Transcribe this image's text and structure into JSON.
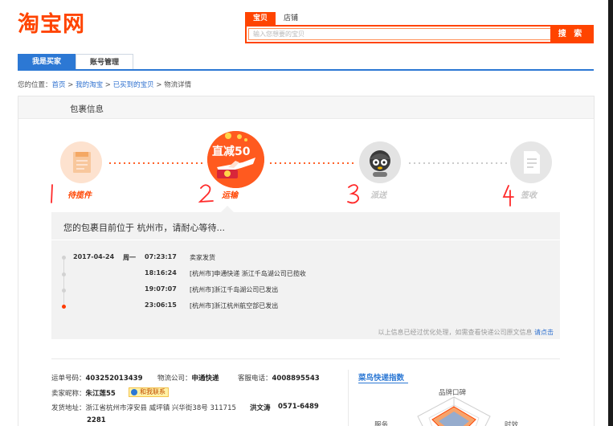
{
  "header": {
    "logo_text": "淘宝网",
    "search_tabs": [
      "宝贝",
      "店铺"
    ],
    "search_placeholder": "输入您想要的宝贝",
    "search_button": "搜 索"
  },
  "nav": {
    "tabs": [
      {
        "label": "我是买家",
        "active": true
      },
      {
        "label": "账号管理",
        "active": false
      }
    ]
  },
  "breadcrumb": {
    "prefix": "您的位置：",
    "items": [
      "首页",
      "我的淘宝",
      "已买到的宝贝"
    ],
    "separator": " > ",
    "current": "物流详情"
  },
  "panel": {
    "title": "包裹信息"
  },
  "steps": [
    {
      "label": "待揽件",
      "icon": "package-icon",
      "annotation": "1",
      "status": "done"
    },
    {
      "label": "运输",
      "icon": "promo-plane-icon",
      "annotation": "2",
      "status": "current",
      "badge": "直减50"
    },
    {
      "label": "派送",
      "icon": "courier-icon",
      "annotation": "3",
      "status": "pending"
    },
    {
      "label": "签收",
      "icon": "document-icon",
      "annotation": "4",
      "status": "pending"
    }
  ],
  "status": {
    "message": "您的包裹目前位于 杭州市，请耐心等待..."
  },
  "timeline": [
    {
      "date": "2017-04-24",
      "weekday": "周一",
      "time": "07:23:17",
      "desc": "卖家发货"
    },
    {
      "date": "",
      "weekday": "",
      "time": "18:16:24",
      "desc": "[杭州市]申通快递 浙江千岛湖公司已揽收"
    },
    {
      "date": "",
      "weekday": "",
      "time": "19:07:07",
      "desc": "[杭州市]浙江千岛湖公司已发出"
    },
    {
      "date": "",
      "weekday": "",
      "time": "23:06:15",
      "desc": "[杭州市]浙江杭州航空部已发出"
    }
  ],
  "footnote": {
    "text": "以上信息已经过优化处理，如需查看快递公司原文信息",
    "link": "请点击"
  },
  "shipment": {
    "tracking_label": "运单号码：",
    "tracking_no": "403252013439",
    "company_label": "物流公司：",
    "company": "申通快递",
    "phone_label": "客服电话：",
    "phone": "4008895543",
    "seller_label": "卖家昵称：",
    "seller": "朱江莲55",
    "contact": "和我联系",
    "address_label": "发货地址：",
    "address": "浙江省杭州市淳安县 威坪镇 兴华街38号 311715",
    "sender": "洪文涛",
    "sender_phone": "0571-6489",
    "sender_phone_cont": "2281"
  },
  "cainiao": {
    "title": "菜鸟快递指数",
    "axes": [
      "品牌口碑",
      "服务",
      "时效"
    ],
    "brand_color": "#ff4400",
    "accent_color": "#2c78d4"
  }
}
